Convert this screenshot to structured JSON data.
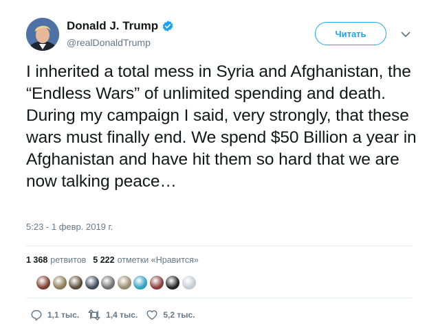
{
  "author": {
    "display_name": "Donald J. Trump",
    "handle": "@realDonaldTrump",
    "verified_color": "#1da1f2"
  },
  "follow_button": {
    "label": "Читать"
  },
  "tweet": {
    "text": "I inherited a total mess in Syria and Afghanistan, the “Endless Wars” of unlimited spending and death. During my campaign I said, very strongly, that these wars must finally end. We spend $50 Billion a year in Afghanistan and have hit them so hard that we are now talking peace…",
    "timestamp": "5:23 - 1 февр. 2019 г."
  },
  "stats": {
    "retweets_count": "1 368",
    "retweets_label": "ретвитов",
    "likes_count": "5 222",
    "likes_label": "отметки «Нравится»"
  },
  "likers": [
    {
      "icon": "liker-avatar-1",
      "color": "#7a3b2e"
    },
    {
      "icon": "liker-avatar-2",
      "color": "#8a7a55"
    },
    {
      "icon": "liker-avatar-3",
      "color": "#5e4a3a"
    },
    {
      "icon": "liker-avatar-4",
      "color": "#3c4a5a"
    },
    {
      "icon": "liker-avatar-5",
      "color": "#6e6e6e"
    },
    {
      "icon": "liker-avatar-6",
      "color": "#9a8a6e"
    },
    {
      "icon": "liker-avatar-7",
      "color": "#2e9fc0"
    },
    {
      "icon": "liker-avatar-8",
      "color": "#8a3a3a"
    },
    {
      "icon": "liker-avatar-9",
      "color": "#222222"
    },
    {
      "icon": "liker-avatar-10",
      "color": "#c3ccd4"
    }
  ],
  "actions": {
    "replies": "1,1 тыс.",
    "retweets": "1,4 тыс.",
    "likes": "5,2 тыс."
  },
  "colors": {
    "accent": "#1da1f2",
    "secondary_text": "#657786",
    "divider": "#e6ecf0"
  }
}
